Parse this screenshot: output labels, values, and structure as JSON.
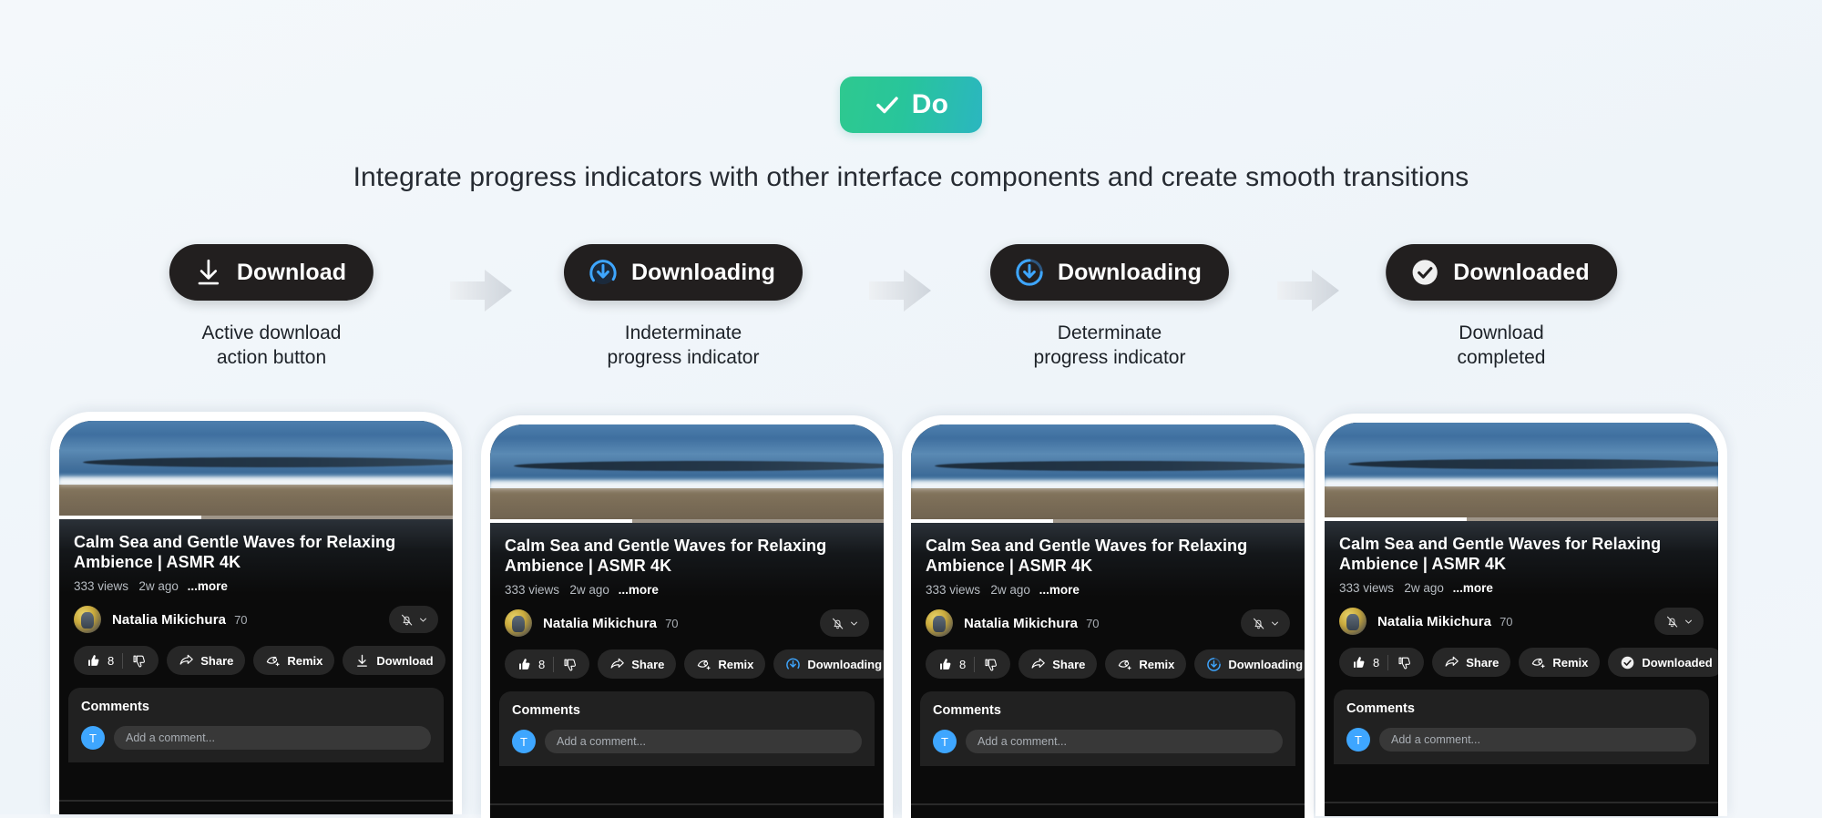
{
  "badge": {
    "label": "Do",
    "icon": "check-icon",
    "gradient_from": "#2ec98f",
    "gradient_to": "#2bb6c0"
  },
  "headline": "Integrate progress indicators with other interface components and create smooth transitions",
  "flow": {
    "arrow_icon": "arrow-right-icon",
    "steps": [
      {
        "label": "Download",
        "icon": "download-arrow-icon",
        "caption_line1": "Active download",
        "caption_line2": "action button"
      },
      {
        "label": "Downloading",
        "icon": "indeterminate-spinner-icon",
        "caption_line1": "Indeterminate",
        "caption_line2": "progress indicator"
      },
      {
        "label": "Downloading",
        "icon": "determinate-progress-icon",
        "caption_line1": "Determinate",
        "caption_line2": "progress indicator"
      },
      {
        "label": "Downloaded",
        "icon": "check-circle-icon",
        "caption_line1": "Download",
        "caption_line2": "completed"
      }
    ]
  },
  "video": {
    "title": "Calm Sea and Gentle Waves for Relaxing Ambience | ASMR 4K",
    "views": "333 views",
    "age": "2w ago",
    "more": "...more",
    "channel_name": "Natalia Mikichura",
    "subscriber_count": "70",
    "bell_icon": "bell-off-icon",
    "bell_chevron_icon": "chevron-down-icon",
    "progress_percent": 36
  },
  "chips": {
    "like_icon": "thumbs-up-icon",
    "like_count": "8",
    "dislike_icon": "thumbs-down-icon",
    "share_icon": "share-arrow-icon",
    "share_label": "Share",
    "remix_icon": "remix-icon",
    "remix_label": "Remix",
    "download_states": [
      {
        "label": "Download",
        "icon": "download-arrow-icon"
      },
      {
        "label": "Downloading",
        "icon": "indeterminate-spinner-icon"
      },
      {
        "label": "Downloading",
        "icon": "determinate-progress-icon"
      },
      {
        "label": "Downloaded",
        "icon": "check-circle-icon"
      }
    ]
  },
  "comments": {
    "title": "Comments",
    "avatar_initial": "T",
    "placeholder": "Add a comment..."
  },
  "colors": {
    "accent_blue": "#3ea6ff",
    "pill_bg": "#221f1f",
    "screen_bg": "#0b0b0b",
    "page_bg": "#f2f6fa"
  }
}
